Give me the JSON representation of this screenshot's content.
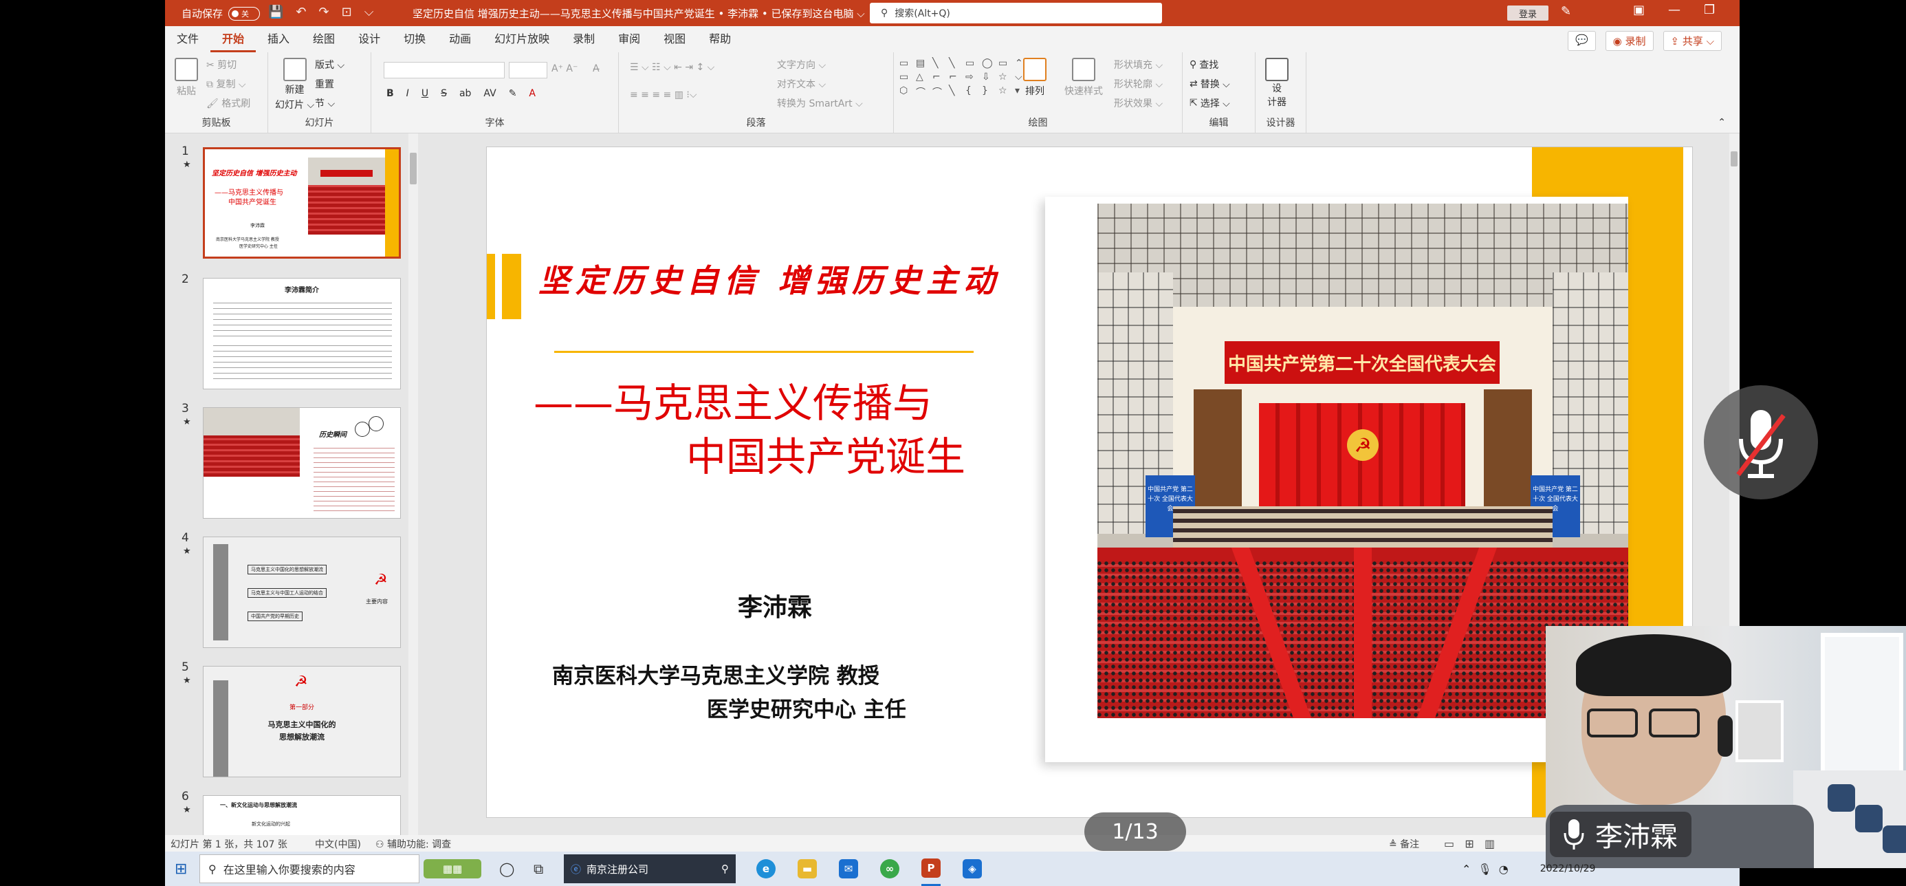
{
  "titlebar": {
    "autosave_label": "自动保存",
    "autosave_state": "关",
    "doc_title": "坚定历史自信  增强历史主动——马克思主义传播与中国共产党诞生 • 李沛霖 • 已保存到这台电脑 ⌵",
    "search_placeholder": "搜索(Alt+Q)",
    "login_label": "登录"
  },
  "tabs": [
    "文件",
    "开始",
    "插入",
    "绘图",
    "设计",
    "切换",
    "动画",
    "幻灯片放映",
    "录制",
    "审阅",
    "视图",
    "帮助"
  ],
  "active_tab": "开始",
  "tabs_right": {
    "record_label": "◉ 录制",
    "share_label": "⇪ 共享 ⌵"
  },
  "ribbon": {
    "clipboard": {
      "label": "剪贴板",
      "paste": "粘贴",
      "cut": "✂ 剪切",
      "copy": "⧉ 复制 ⌵",
      "format_painter": "🖌 格式刷"
    },
    "slides": {
      "label": "幻灯片",
      "new_slide": "新建",
      "new_slide2": "幻灯片 ⌵",
      "layout": "版式 ⌵",
      "reset": "重置",
      "section": "节 ⌵"
    },
    "font": {
      "label": "字体",
      "bold": "B",
      "italic": "I",
      "underline": "U",
      "strike": "S",
      "spacing": "ab",
      "shadow": "AV",
      "highlight": "✎",
      "color": "A"
    },
    "paragraph": {
      "label": "段落",
      "direction": "文字方向 ⌵",
      "align_text": "对齐文本 ⌵",
      "smartart": "转换为 SmartArt ⌵"
    },
    "drawing": {
      "label": "绘图",
      "arrange": "排列",
      "quick_styles": "快速样式",
      "fill": "形状填充 ⌵",
      "outline": "形状轮廓 ⌵",
      "effects": "形状效果 ⌵"
    },
    "editing": {
      "label": "编辑",
      "find": "查找",
      "replace": "替换 ⌵",
      "select": "选择 ⌵"
    },
    "designer": {
      "label": "设计器",
      "btn1": "设",
      "btn2": "计器"
    }
  },
  "thumbnails": [
    {
      "num": "1",
      "star": "★"
    },
    {
      "num": "2",
      "star": ""
    },
    {
      "num": "3",
      "star": "★"
    },
    {
      "num": "4",
      "star": "★"
    },
    {
      "num": "5",
      "star": "★"
    },
    {
      "num": "6",
      "star": "★"
    }
  ],
  "thumb_texts": {
    "t1_title": "坚定历史自信  增强历史主动",
    "t1_sub1": "——马克思主义传播与",
    "t1_sub2": "中国共产党诞生",
    "t1_author": "李沛霖",
    "t1_aff": "南京医科大学马克思主义学院 教授",
    "t1_aff2": "医学史研究中心 主任",
    "t2_title": "李沛霖简介",
    "t3_title": "历史瞬间",
    "t4_item1": "马克思主义中国化的思想解放潮流",
    "t4_item2": "马克思主义与中国工人运动的结合",
    "t4_item3": "中国共产党的早期历史",
    "t4_side": "主要内容",
    "t5_part": "第一部分",
    "t5_title1": "马克思主义中国化的",
    "t5_title2": "思想解放潮流",
    "t6_title": "一、新文化运动与思想解放潮流",
    "t6_sub": "新文化运动的兴起"
  },
  "slide": {
    "title": "坚定历史自信  增强历史主动",
    "subtitle_line1": "——马克思主义传播与",
    "subtitle_line2": "中国共产党诞生",
    "author": "李沛霖",
    "affiliation_line1": "南京医科大学马克思主义学院  教授",
    "affiliation_line2": "医学史研究中心  主任",
    "photo_banner": "中国共产党第二十次全国代表大会",
    "screen_text": "中国共产党 第二十次 全国代表大会"
  },
  "statusbar": {
    "slide_info": "幻灯片 第 1 张，共 107 张",
    "language": "中文(中国)",
    "accessibility": "⚇ 辅助功能: 调查",
    "notes": "≜ 备注"
  },
  "page_counter": "1/13",
  "taskbar": {
    "search_placeholder": "在这里输入你要搜索的内容",
    "company_label": "南京注册公司",
    "date": "2022/10/29"
  },
  "webcam": {
    "name": "李沛霖"
  },
  "colors": {
    "accent": "#c43e1c",
    "slide_red": "#e00000",
    "slide_yellow": "#f7b500"
  }
}
